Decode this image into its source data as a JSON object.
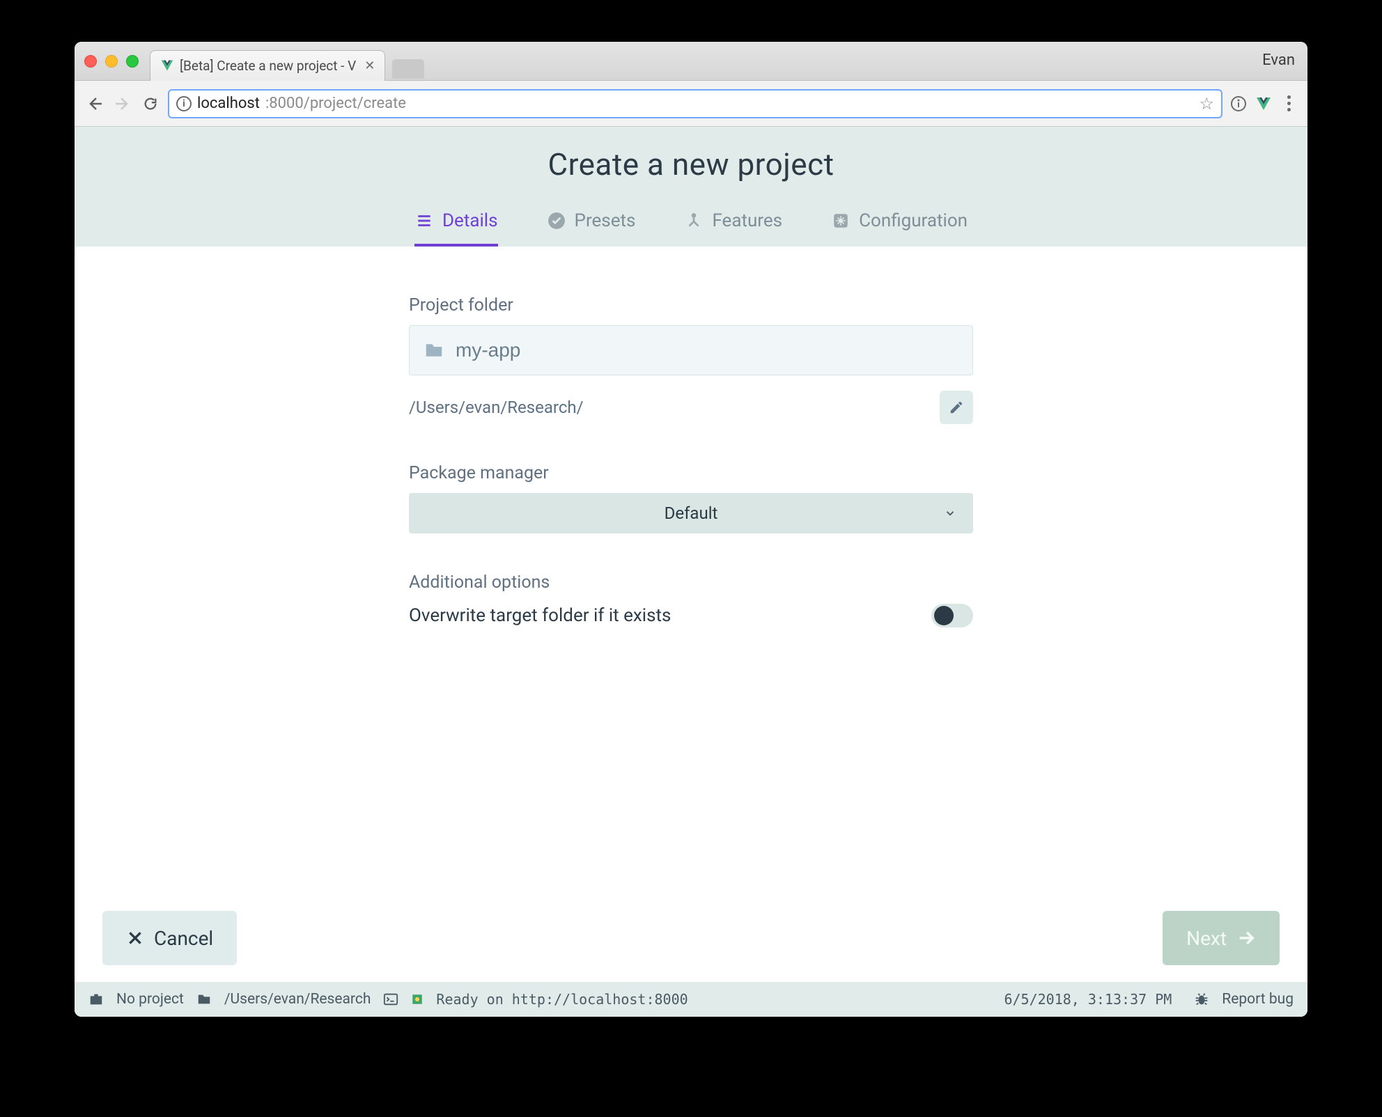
{
  "browser": {
    "tab_title": "[Beta] Create a new project - V",
    "profile": "Evan",
    "url_host": "localhost",
    "url_port_path": ":8000/project/create"
  },
  "header": {
    "title": "Create a new project"
  },
  "tabs": {
    "details": "Details",
    "presets": "Presets",
    "features": "Features",
    "configuration": "Configuration"
  },
  "form": {
    "project_folder_label": "Project folder",
    "project_folder_value": "my-app",
    "base_path": "/Users/evan/Research/",
    "package_manager_label": "Package manager",
    "package_manager_value": "Default",
    "additional_options_label": "Additional options",
    "overwrite_label": "Overwrite target folder if it exists"
  },
  "actions": {
    "cancel": "Cancel",
    "next": "Next"
  },
  "status": {
    "no_project": "No project",
    "cwd": "/Users/evan/Research",
    "ready": "Ready on http://localhost:8000",
    "timestamp": "6/5/2018, 3:13:37 PM",
    "report_bug": "Report bug"
  }
}
